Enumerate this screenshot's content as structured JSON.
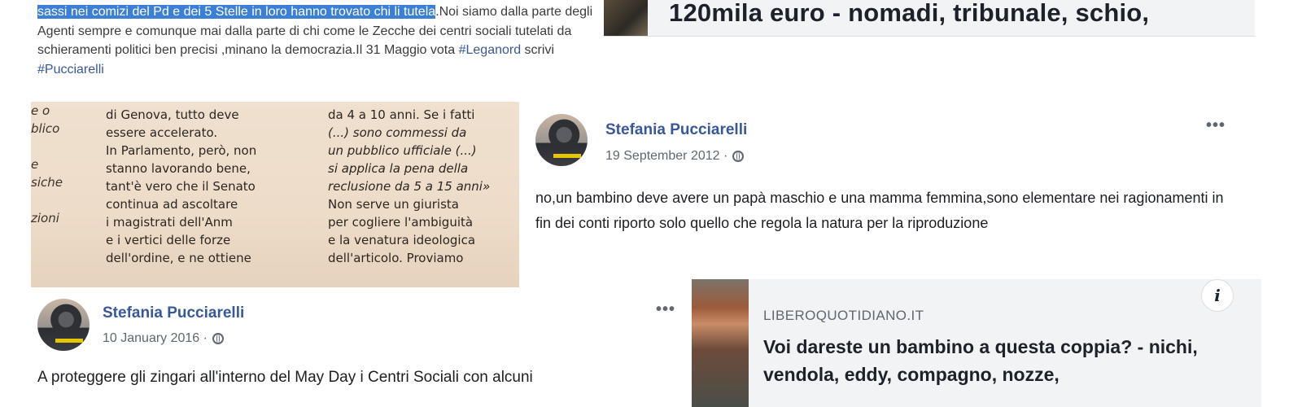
{
  "snippet_top_left": {
    "highlighted": "sassi nei comizi del Pd e dei 5 Stelle in loro hanno trovato chi li tutela",
    "text_after": ".Noi siamo dalla parte degli Agenti sempre e comunque mai dalla parte di chi come le Zecche dei centri sociali tutelati da schieramenti politici ben precisi ,minano la democrazia.Il 31 Maggio vota ",
    "hashtag1": "#Leganord",
    "text_mid": " scrivi ",
    "hashtag2": "#Pucciarelli"
  },
  "headline_top_right": {
    "text": "120mila euro - nomadi, tribunale, schio,"
  },
  "newspaper": {
    "col0": [
      "e o",
      "blico",
      "",
      "e",
      "siche",
      "",
      "zioni",
      ""
    ],
    "col1_top": "...",
    "col1": [
      "di Genova, tutto deve",
      "essere accelerato.",
      "In Parlamento, però, non",
      "stanno lavorando bene,",
      "tant'è vero che il Senato",
      "continua ad ascoltare",
      "i magistrati dell'Anm",
      "e i vertici delle forze",
      "dell'ordine, e ne ottiene"
    ],
    "col2": [
      "da 4 a 10 anni. Se i fatti",
      "(...) sono commessi da",
      "un pubblico ufficiale (...)",
      "si applica la pena della",
      "reclusione da 5 a 15 anni»",
      "Non serve un giurista",
      "per cogliere l'ambiguità",
      "e la venatura ideologica",
      "dell'articolo. Proviamo"
    ]
  },
  "post_2012": {
    "author": "Stefania Pucciarelli",
    "date": "19 September 2012 ·",
    "more": "•••",
    "text": "no,un bambino deve avere un papà maschio e una mamma femmina,sono elementare nei ragionamenti in fin dei conti riporto solo quello che regola la natura per la riproduzione"
  },
  "post_2016": {
    "author": "Stefania Pucciarelli",
    "date": "10 January 2016 ·",
    "more": "•••",
    "text": "A proteggere gli zingari all'interno del May Day i Centri Sociali con alcuni"
  },
  "link_card": {
    "domain": "LIBEROQUOTIDIANO.IT",
    "title": "Voi dareste un bambino a questa coppia? - nichi, vendola, eddy, compagno, nozze,",
    "info": "i"
  }
}
